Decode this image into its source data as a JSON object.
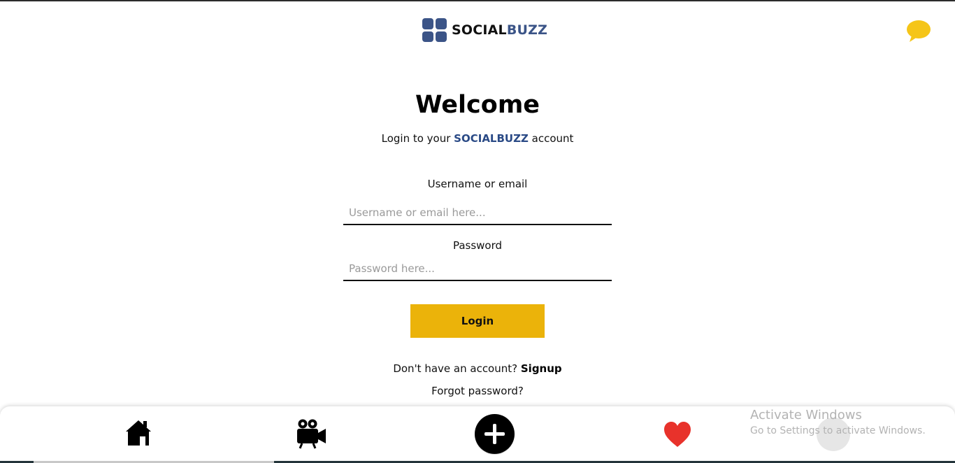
{
  "header": {
    "brand_primary": "SOCIAL",
    "brand_secondary": "BUZZ",
    "chat_icon": "chat-bubble-icon"
  },
  "login": {
    "title": "Welcome",
    "subtitle_prefix": "Login to your ",
    "subtitle_brand": "SOCIALBUZZ",
    "subtitle_suffix": " account",
    "username_label": "Username or email",
    "username_placeholder": "Username or email here...",
    "username_value": "",
    "password_label": "Password",
    "password_placeholder": "Password here...",
    "password_value": "",
    "login_button": "Login",
    "no_account_text": "Don't have an account? ",
    "signup_link": "Signup",
    "forgot_link": "Forgot password?"
  },
  "bottom_nav": {
    "items": [
      {
        "name": "home",
        "icon": "home-icon"
      },
      {
        "name": "video",
        "icon": "video-camera-icon"
      },
      {
        "name": "add",
        "icon": "plus-circle-icon"
      },
      {
        "name": "favorites",
        "icon": "heart-icon"
      }
    ]
  },
  "watermark": {
    "title": "Activate Windows",
    "subtitle": "Go to Settings to activate Windows."
  },
  "colors": {
    "brand_blue": "#3b5487",
    "accent_yellow": "#ebb30a",
    "chat_yellow": "#f5c518",
    "heart_red": "#e8322b"
  }
}
